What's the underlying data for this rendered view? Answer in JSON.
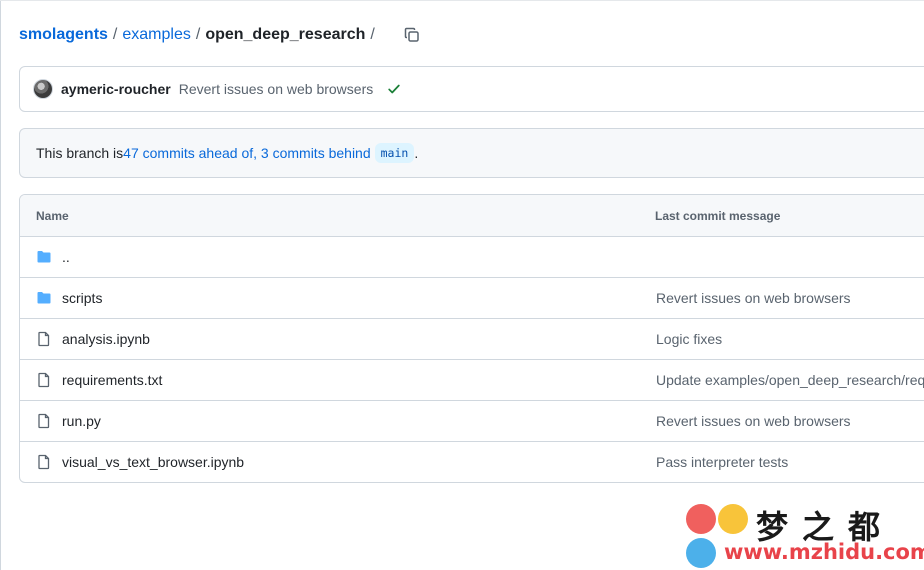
{
  "breadcrumb": {
    "repo": "smolagents",
    "folder": "examples",
    "current": "open_deep_research",
    "separator": "/",
    "trailing_separator": "/"
  },
  "latest_commit": {
    "author": "aymeric-roucher",
    "message": "Revert issues on web browsers",
    "status_icon": "check-icon",
    "status_color": "#1a7f37"
  },
  "branch_status": {
    "prefix": "This branch is ",
    "ahead": "47 commits ahead of,",
    "behind": "3 commits behind",
    "base_branch": "main",
    "suffix": "."
  },
  "file_table": {
    "columns": {
      "name": "Name",
      "last_commit": "Last commit message"
    },
    "rows": [
      {
        "type": "folder",
        "name": "..",
        "message": ""
      },
      {
        "type": "folder",
        "name": "scripts",
        "message": "Revert issues on web browsers"
      },
      {
        "type": "file",
        "name": "analysis.ipynb",
        "message": "Logic fixes"
      },
      {
        "type": "file",
        "name": "requirements.txt",
        "message": "Update examples/open_deep_research/requirements.txt"
      },
      {
        "type": "file",
        "name": "run.py",
        "message": "Revert issues on web browsers"
      },
      {
        "type": "file",
        "name": "visual_vs_text_browser.ipynb",
        "message": "Pass interpreter tests"
      }
    ]
  },
  "watermark": {
    "title": "梦之都",
    "url": "www.mzhidu.com"
  },
  "colors": {
    "link": "#0969da",
    "folder_icon": "#54aeff",
    "muted_text": "#59636e",
    "border": "#d0d7de"
  }
}
